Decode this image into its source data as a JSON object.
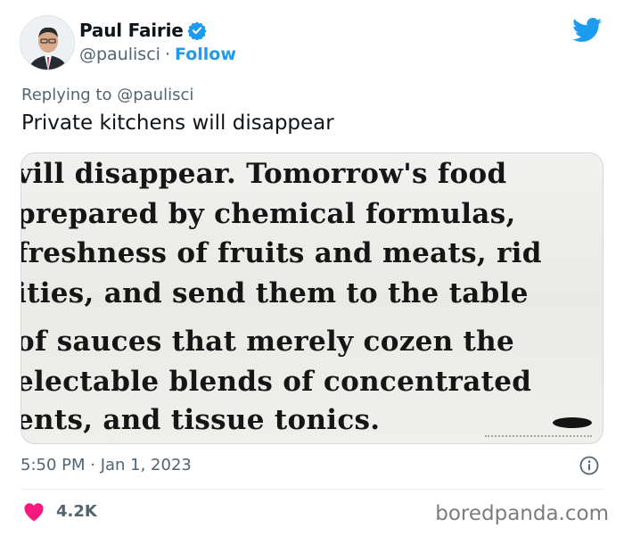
{
  "author": {
    "display_name": "Paul Fairie",
    "handle": "@paulisci",
    "separator": "·",
    "follow_label": "Follow",
    "verified_icon": "verified-badge-icon",
    "avatar_icon": "avatar"
  },
  "brand_icon": "twitter-bird-icon",
  "reply_to": "Replying to @paulisci",
  "tweet_text": "Private kitchens will disappear",
  "clipping": {
    "lines": [
      "vill disappear.  Tomorrow's food",
      "prepared by chemical formulas,",
      "freshness of fruits and meats, rid",
      "ities, and send them to the table",
      "of sauces that merely cozen the",
      "electable blends of concentrated",
      "ents, and tissue tonics."
    ]
  },
  "timestamp": "5:50 PM · Jan 1, 2023",
  "info_icon": "info-icon",
  "likes": {
    "icon": "heart-icon",
    "count": "4.2K"
  },
  "watermark": "boredpanda.com",
  "colors": {
    "accent": "#1d9bf0",
    "text": "#0f1419",
    "muted": "#536471",
    "like": "#f91880"
  }
}
